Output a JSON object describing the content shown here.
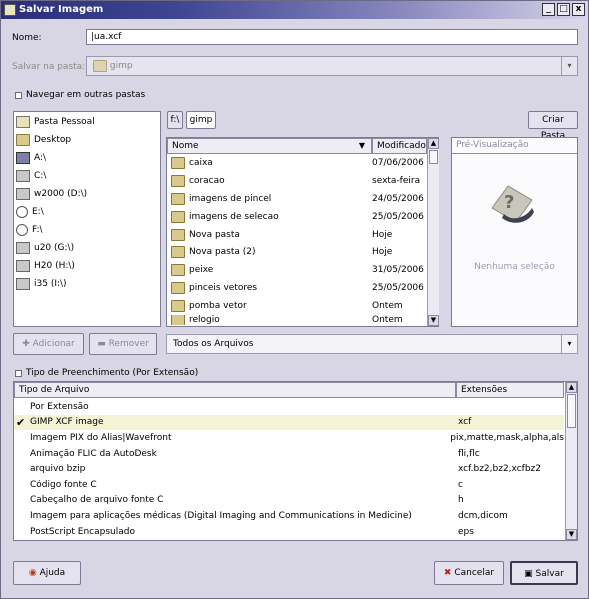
{
  "window": {
    "title": "Salvar Imagem",
    "controls": [
      "_",
      "□",
      "x"
    ]
  },
  "name_field": {
    "label": "Nome:",
    "value": "|ua.xcf"
  },
  "save_in": {
    "label": "Salvar na pasta:",
    "value": "gimp"
  },
  "browse_other": {
    "label": "Navegar em outras pastas"
  },
  "path": {
    "root": "f:\\",
    "current": "gimp"
  },
  "create_folder_button": "Criar Pasta",
  "places": [
    {
      "label": "Pasta Pessoal",
      "icon": "home-icon"
    },
    {
      "label": "Desktop",
      "icon": "folder-icon"
    },
    {
      "label": "A:\\",
      "icon": "floppy-icon"
    },
    {
      "label": "C:\\",
      "icon": "drive-icon"
    },
    {
      "label": "w2000 (D:\\)",
      "icon": "drive-icon"
    },
    {
      "label": "E:\\",
      "icon": "cd-icon"
    },
    {
      "label": "F:\\",
      "icon": "cd-icon"
    },
    {
      "label": "u20 (G:\\)",
      "icon": "drive-icon"
    },
    {
      "label": "H20 (H:\\)",
      "icon": "drive-icon"
    },
    {
      "label": "i35 (I:\\)",
      "icon": "drive-icon"
    }
  ],
  "files": {
    "columns": {
      "name": "Nome",
      "modified": "Modificado"
    },
    "rows": [
      {
        "name": "caixa",
        "modified": "07/06/2006"
      },
      {
        "name": "coracao",
        "modified": "sexta-feira"
      },
      {
        "name": "imagens de pincel",
        "modified": "24/05/2006"
      },
      {
        "name": "imagens de selecao",
        "modified": "25/05/2006"
      },
      {
        "name": "Nova pasta",
        "modified": "Hoje"
      },
      {
        "name": "Nova pasta (2)",
        "modified": "Hoje"
      },
      {
        "name": "peixe",
        "modified": "31/05/2006"
      },
      {
        "name": "pinceis vetores",
        "modified": "25/05/2006"
      },
      {
        "name": "pomba vetor",
        "modified": "Ontem"
      },
      {
        "name": "relogio",
        "modified": "Ontem"
      }
    ]
  },
  "preview": {
    "title": "Pré-Visualização",
    "empty_text": "Nenhuma seleção"
  },
  "add_button": "Adicionar",
  "remove_button": "Remover",
  "filter": {
    "value": "Todos os Arquivos"
  },
  "filetype": {
    "toggle_label": "Tipo de Preenchimento (Por Extensão)",
    "columns": {
      "type": "Tipo de Arquivo",
      "ext": "Extensões"
    },
    "rows": [
      {
        "type": "Por Extensão",
        "ext": ""
      },
      {
        "type": "GIMP XCF image",
        "ext": "xcf",
        "selected": true
      },
      {
        "type": "Imagem PIX do Alias|Wavefront",
        "ext": "pix,matte,mask,alpha,als"
      },
      {
        "type": "Animação FLIC da AutoDesk",
        "ext": "fli,flc"
      },
      {
        "type": "arquivo bzip",
        "ext": "xcf.bz2,bz2,xcfbz2"
      },
      {
        "type": "Código fonte C",
        "ext": "c"
      },
      {
        "type": "Cabeçalho de arquivo fonte C",
        "ext": "h"
      },
      {
        "type": "Imagem para aplicações médicas (Digital Imaging and Communications in Medicine)",
        "ext": "dcm,dicom"
      },
      {
        "type": "PostScript Encapsulado",
        "ext": "eps"
      }
    ]
  },
  "help_button": "Ajuda",
  "cancel_button": "Cancelar",
  "save_button": "Salvar"
}
